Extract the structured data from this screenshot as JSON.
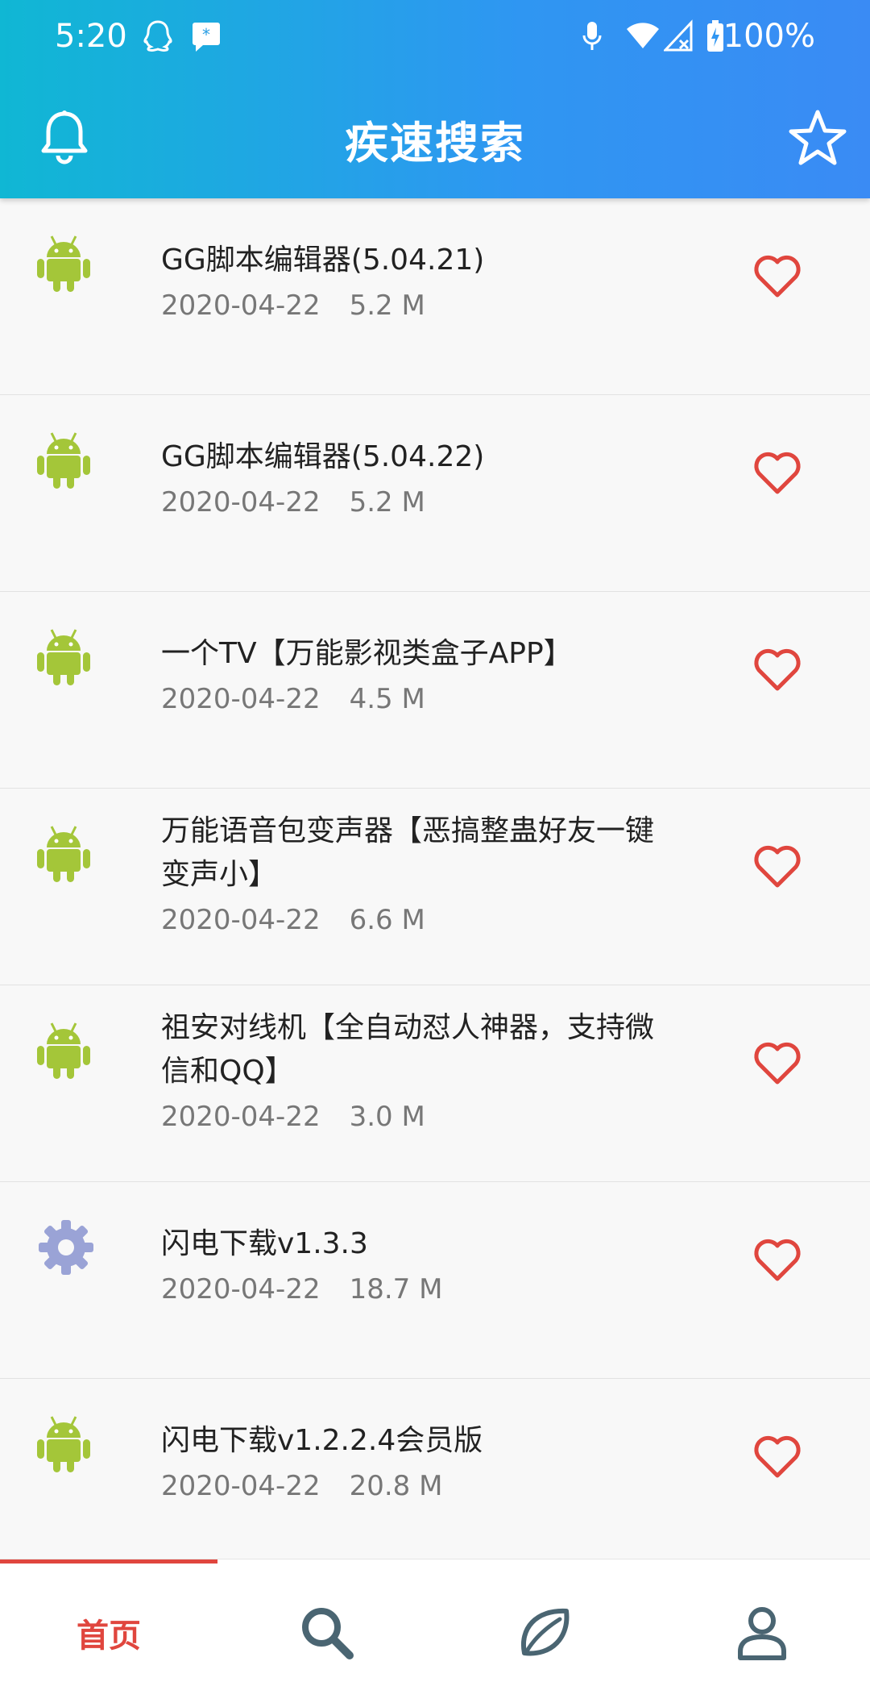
{
  "status_bar": {
    "time": "5:20",
    "battery": "100%",
    "icons": [
      "qq-icon",
      "message-icon",
      "mic-icon",
      "wifi-icon",
      "signal-icon",
      "battery-icon"
    ]
  },
  "header": {
    "title": "疾速搜索",
    "left_icon": "bell-icon",
    "right_icon": "star-icon"
  },
  "items": [
    {
      "name": "GG脚本编辑器(5.04.21)",
      "date": "2020-04-22",
      "size": "5.2 M",
      "icon": "android-icon"
    },
    {
      "name": "GG脚本编辑器(5.04.22)",
      "date": "2020-04-22",
      "size": "5.2 M",
      "icon": "android-icon"
    },
    {
      "name": "一个TV【万能影视类盒子APP】",
      "date": "2020-04-22",
      "size": "4.5 M",
      "icon": "android-icon"
    },
    {
      "name": "万能语音包变声器【恶搞整蛊好友一键变声小】",
      "date": "2020-04-22",
      "size": "6.6 M",
      "icon": "android-icon"
    },
    {
      "name": "祖安对线机【全自动怼人神器，支持微信和QQ】",
      "date": "2020-04-22",
      "size": "3.0 M",
      "icon": "android-icon"
    },
    {
      "name": "闪电下载v1.3.3",
      "date": "2020-04-22",
      "size": "18.7 M",
      "icon": "gear-icon"
    },
    {
      "name": "闪电下载v1.2.2.4会员版",
      "date": "2020-04-22",
      "size": "20.8 M",
      "icon": "android-icon"
    }
  ],
  "colors": {
    "accent": "#e0463e",
    "header_start": "#10b7d4",
    "header_end": "#3a8bf4",
    "android_green": "#a4c639",
    "gear": "#9aa3d6",
    "tab_icon": "#4a6572"
  },
  "tabbar": {
    "tabs": [
      {
        "label": "首页",
        "active": true
      },
      {
        "icon": "search-icon"
      },
      {
        "icon": "leaf-icon"
      },
      {
        "icon": "user-icon"
      }
    ]
  }
}
